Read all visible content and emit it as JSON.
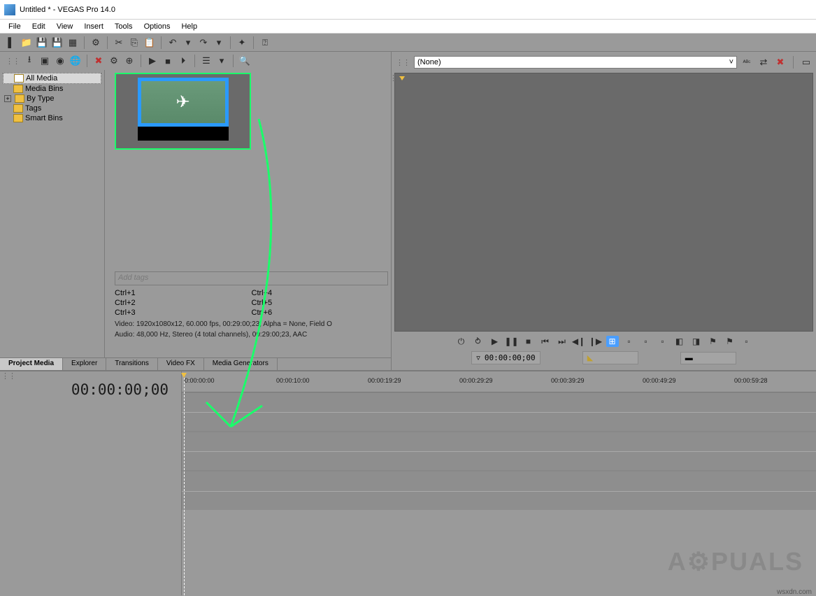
{
  "window": {
    "title": "Untitled * - VEGAS Pro 14.0"
  },
  "menu": {
    "items": [
      "File",
      "Edit",
      "View",
      "Insert",
      "Tools",
      "Options",
      "Help"
    ]
  },
  "tree": {
    "items": [
      "All Media",
      "Media Bins",
      "By Type",
      "Tags",
      "Smart Bins"
    ]
  },
  "media": {
    "addtags_placeholder": "Add tags",
    "shortcuts_left": [
      "Ctrl+1",
      "Ctrl+2",
      "Ctrl+3"
    ],
    "shortcuts_right": [
      "Ctrl+4",
      "Ctrl+5",
      "Ctrl+6"
    ],
    "meta1": "Video: 1920x1080x12, 60.000 fps, 00:29:00;23, Alpha = None, Field O",
    "meta2": "Audio: 48,000 Hz, Stereo (4 total channels), 00:29:00;23, AAC"
  },
  "tabs": {
    "left": [
      "Project Media",
      "Explorer",
      "Transitions",
      "Video FX",
      "Media Generators"
    ]
  },
  "preview": {
    "selector": "(None)"
  },
  "transport": {
    "timecode": "00:00:00;00"
  },
  "timeline": {
    "position": "00:00:00;00",
    "ruler": [
      "0:00:00:00",
      "00:00:10:00",
      "00:00:19:29",
      "00:00:29:29",
      "00:00:39:29",
      "00:00:49:29",
      "00:00:59:28"
    ]
  },
  "footer": {
    "site": "wsxdn.com"
  },
  "watermark": {
    "text": "A⚙PUALS"
  }
}
